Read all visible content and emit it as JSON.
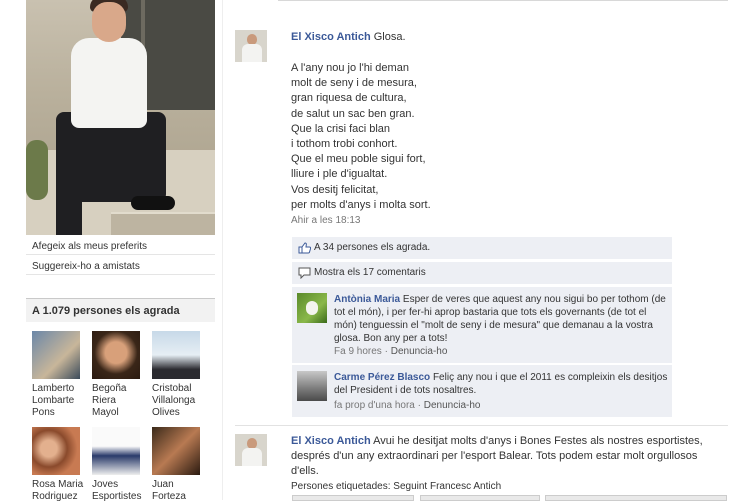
{
  "sidebar": {
    "links": [
      "Afegeix als meus preferits",
      "Suggereix-ho a amistats"
    ],
    "likes_box_title": "A 1.079 persones els agrada",
    "friends": [
      {
        "name": "Lamberto Lombarte Pons"
      },
      {
        "name": "Begoña Riera Mayol"
      },
      {
        "name": "Cristobal Villalonga Olives"
      },
      {
        "name": "Rosa Maria Rodriguez"
      },
      {
        "name": "Joves Esportistes"
      },
      {
        "name": "Juan Forteza"
      }
    ]
  },
  "posts": [
    {
      "author": "El Xisco Antich",
      "title": "Glosa.",
      "lines": [
        "A l'any nou jo l'hi deman",
        "molt de seny i de mesura,",
        "gran riquesa de cultura,",
        "de salut un sac ben gran.",
        "Que la crisi faci blan",
        "i tothom trobi conhort.",
        "Que el meu poble sigui fort,",
        "lliure i ple d'igualtat.",
        "Vos desitj felicitat,",
        "per molts d'anys i molta sort."
      ],
      "time": "Ahir a les 18:13",
      "likes": "A 34 persones els agrada.",
      "show_comments": "Mostra els 17 comentaris",
      "comments": [
        {
          "author": "Antònia Maria",
          "text": "Esper de veres que aquest any nou sigui bo per tothom (de tot el món), i per fer-hi aprop bastaria que tots els governants (de tot el món) tenguessin el \"molt de seny i de mesura\" que demanau a la vostra glosa. Bon any per a tots!",
          "time": "Fa 9 hores",
          "report": "Denuncia-ho"
        },
        {
          "author": "Carme Pérez Blasco",
          "text": "Feliç any nou i que el 2011 es compleixin els desitjos del President i de tots nosaltres.",
          "time": "fa prop d'una hora",
          "report": "Denuncia-ho"
        }
      ]
    },
    {
      "author": "El Xisco Antich",
      "text": "Avui he desitjat molts d'anys i Bones Festes als nostres esportistes, després d'un any extraordinari per l'esport Balear. Tots podem estar molt orgullosos d'ells.",
      "tagged": "Persones etiquetades: Seguint Francesc Antich"
    }
  ],
  "separator": "·",
  "colors": {
    "link": "#3b5998",
    "ufi_bg": "#edeff4",
    "box_header": "#f2f2f2"
  },
  "icons": [
    "thumbs-up-icon",
    "comment-bubble-icon"
  ]
}
